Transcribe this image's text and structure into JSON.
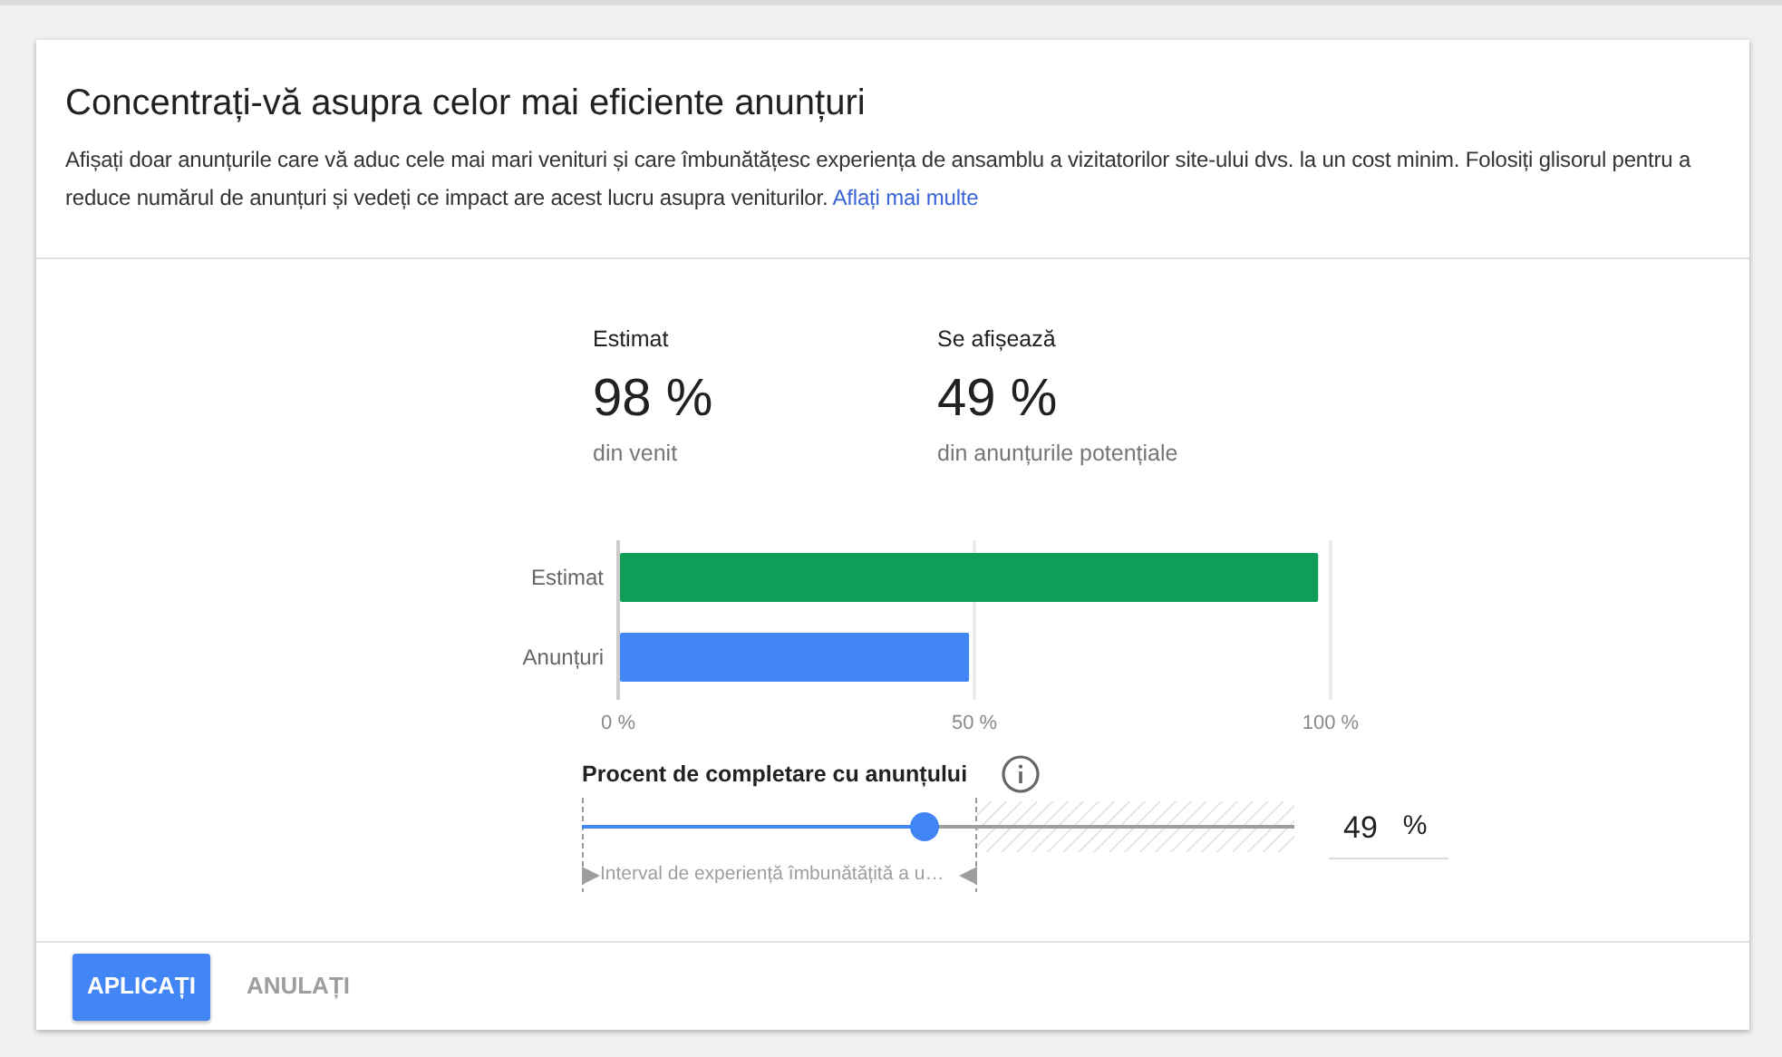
{
  "dialog": {
    "title": "Concentrați-vă asupra celor mai eficiente anunțuri",
    "description": "Afișați doar anunțurile care vă aduc cele mai mari venituri și care îmbunătățesc experiența de ansamblu a vizitatorilor site-ului dvs. la un cost minim. Folosiți glisorul pentru a reduce numărul de anunțuri și vedeți ce impact are acest lucru asupra veniturilor.",
    "link": "Aflați mai multe"
  },
  "stats": [
    {
      "label": "Estimat",
      "value": "98 %",
      "caption": "din venit"
    },
    {
      "label": "Se afișează",
      "value": "49 %",
      "caption": "din anunțurile potențiale"
    }
  ],
  "chart_data": {
    "type": "bar",
    "orientation": "horizontal",
    "categories": [
      "Estimat",
      "Anunțuri"
    ],
    "series": [
      {
        "color": "#0f9d58",
        "values": [
          98,
          null
        ]
      },
      {
        "color": "#4285f4",
        "values": [
          null,
          49
        ]
      }
    ],
    "xlim": [
      0,
      100
    ],
    "xticks": [
      {
        "value": 0,
        "label": "0 %"
      },
      {
        "value": 50,
        "label": "50 %"
      },
      {
        "value": 100,
        "label": "100 %"
      }
    ]
  },
  "slider": {
    "label": "Procent de completare cu anunțului",
    "level": 0.48,
    "value": "49",
    "unit": "%",
    "range_caption": "Interval de experiență îmbunătățită a u…"
  },
  "buttons": [
    {
      "label": "APLICAȚI",
      "kind": "primary"
    },
    {
      "label": "ANULAȚI",
      "kind": "flat"
    }
  ]
}
